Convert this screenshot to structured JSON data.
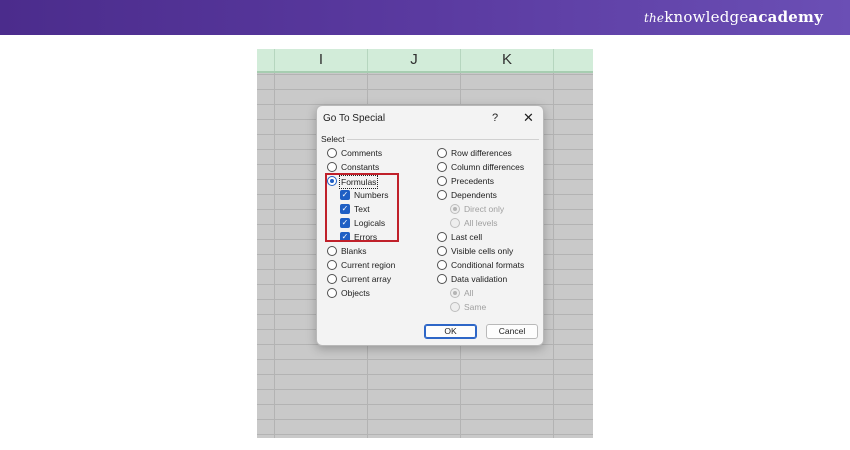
{
  "brand": {
    "logo_prefix": "the",
    "logo_main": "knowledge",
    "logo_bold": "academy"
  },
  "sheet": {
    "columns": [
      "I",
      "J",
      "K"
    ]
  },
  "dialog": {
    "title": "Go To Special",
    "help": "?",
    "close": "✕",
    "group_label": "Select",
    "left_options": [
      {
        "label": "Comments",
        "checked": false
      },
      {
        "label": "Constants",
        "checked": false
      },
      {
        "label": "Formulas",
        "checked": true
      },
      {
        "label": "Numbers",
        "sub": true,
        "checked": true
      },
      {
        "label": "Text",
        "sub": true,
        "checked": true
      },
      {
        "label": "Logicals",
        "sub": true,
        "checked": true
      },
      {
        "label": "Errors",
        "sub": true,
        "checked": true
      },
      {
        "label": "Blanks",
        "checked": false
      },
      {
        "label": "Current region",
        "checked": false
      },
      {
        "label": "Current array",
        "checked": false
      },
      {
        "label": "Objects",
        "checked": false
      }
    ],
    "right_options": [
      {
        "label": "Row differences",
        "checked": false
      },
      {
        "label": "Column differences",
        "checked": false
      },
      {
        "label": "Precedents",
        "checked": false
      },
      {
        "label": "Dependents",
        "checked": false
      },
      {
        "label": "Direct only",
        "sub": true,
        "disabled": true,
        "checked": true
      },
      {
        "label": "All levels",
        "sub": true,
        "disabled": true,
        "checked": false
      },
      {
        "label": "Last cell",
        "checked": false
      },
      {
        "label": "Visible cells only",
        "checked": false
      },
      {
        "label": "Conditional formats",
        "checked": false
      },
      {
        "label": "Data validation",
        "checked": false
      },
      {
        "label": "All",
        "sub": true,
        "disabled": true,
        "checked": true
      },
      {
        "label": "Same",
        "sub": true,
        "disabled": true,
        "checked": false
      }
    ],
    "ok_label": "OK",
    "cancel_label": "Cancel"
  },
  "colors": {
    "banner": "#5a3aa0",
    "accent": "#1f5fc4",
    "highlight": "#c0202a",
    "column_header": "#d2ecd9"
  }
}
